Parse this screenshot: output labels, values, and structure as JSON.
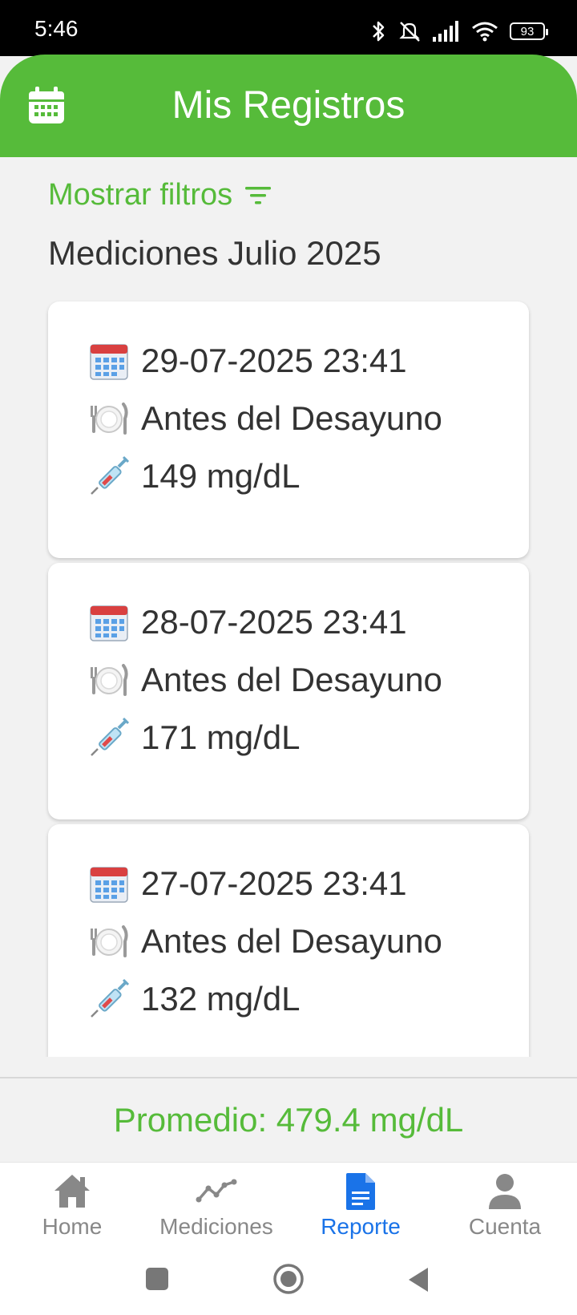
{
  "status_bar": {
    "time": "5:46",
    "battery": "93",
    "icons": [
      "bluetooth-icon",
      "mute-icon",
      "signal-icon",
      "wifi-icon",
      "battery-icon"
    ]
  },
  "header": {
    "title": "Mis Registros",
    "icon": "calendar-icon",
    "color": "#56bb3a"
  },
  "filters": {
    "label": "Mostrar filtros",
    "icon": "filter-icon"
  },
  "month_heading": "Mediciones Julio 2025",
  "records": [
    {
      "datetime": "29-07-2025 23:41",
      "meal": "Antes del Desayuno",
      "value": "149 mg/dL"
    },
    {
      "datetime": "28-07-2025 23:41",
      "meal": "Antes del Desayuno",
      "value": "171 mg/dL"
    },
    {
      "datetime": "27-07-2025 23:41",
      "meal": "Antes del Desayuno",
      "value": "132 mg/dL"
    }
  ],
  "summary": {
    "text": "Promedio: 479.4 mg/dL"
  },
  "bottom_nav": [
    {
      "label": "Home",
      "icon": "home-icon",
      "active": false
    },
    {
      "label": "Mediciones",
      "icon": "chart-line-icon",
      "active": false
    },
    {
      "label": "Reporte",
      "icon": "document-icon",
      "active": true
    },
    {
      "label": "Cuenta",
      "icon": "person-icon",
      "active": false
    }
  ],
  "colors": {
    "accent": "#56bb3a",
    "active_nav": "#1a73e8",
    "inactive_nav": "#888888"
  }
}
